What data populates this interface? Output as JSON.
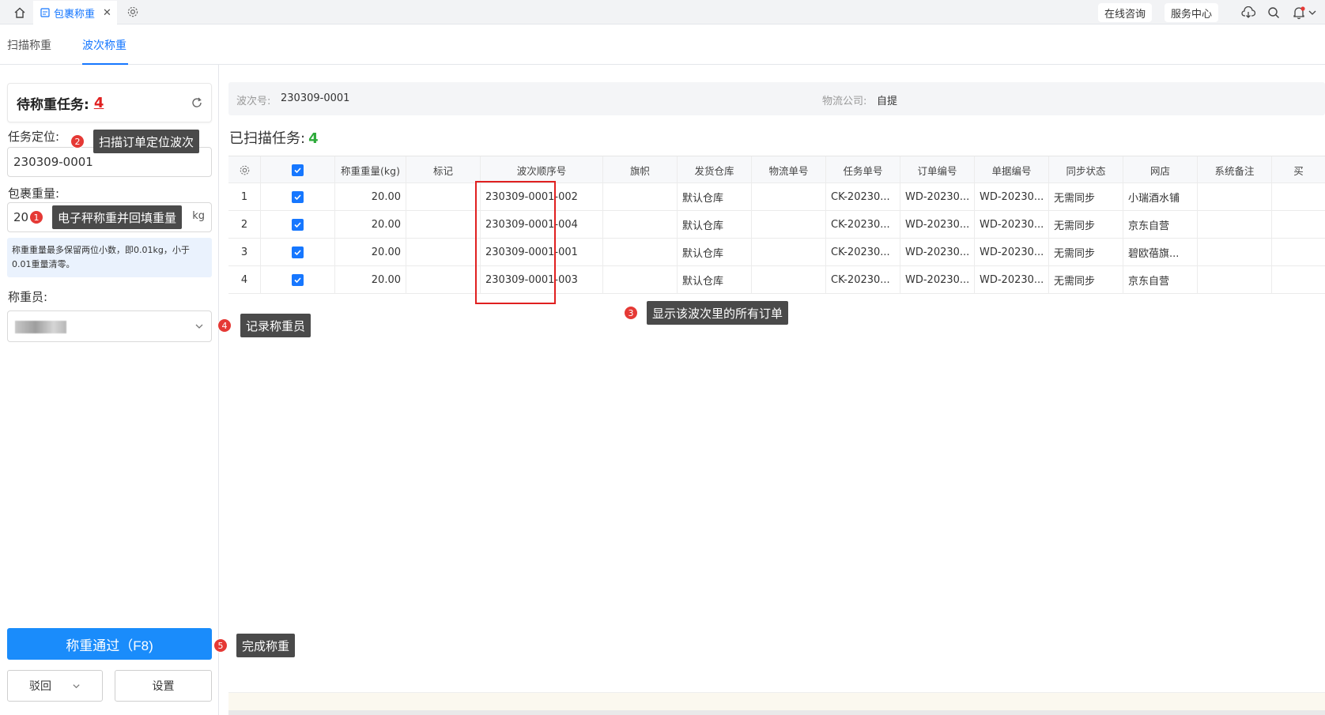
{
  "topbar": {
    "tab_title": "包裹称重",
    "close_glyph": "✕",
    "consult_label": "在线咨询",
    "service_label": "服务中心",
    "icons": [
      "home-icon",
      "tab-page-icon",
      "gear-icon",
      "cloud-download-icon",
      "search-icon",
      "bell-icon"
    ]
  },
  "subtabs": [
    {
      "label": "扫描称重",
      "active": false
    },
    {
      "label": "波次称重",
      "active": true
    }
  ],
  "left": {
    "pending_label": "待称重任务:",
    "pending_count": "4",
    "task_locate_label": "任务定位:",
    "task_locate_value": "230309-0001",
    "package_weight_label": "包裹重量:",
    "package_weight_value": "20",
    "unit": "kg",
    "hint": "称重重量最多保留两位小数，即0.01kg，小于0.01重量清零。",
    "weigher_label": "称重员:",
    "primary_button": "称重通过（F8)",
    "reject_button": "驳回",
    "settings_button": "设置"
  },
  "annotations": [
    {
      "num": "1",
      "text": "电子秤称重并回填重量"
    },
    {
      "num": "2",
      "text": "扫描订单定位波次"
    },
    {
      "num": "3",
      "text": "显示该波次里的所有订单"
    },
    {
      "num": "4",
      "text": "记录称重员"
    },
    {
      "num": "5",
      "text": "完成称重"
    }
  ],
  "info": {
    "wave_label": "波次号:",
    "wave_value": "230309-0001",
    "logistics_label": "物流公司:",
    "logistics_value": "自提"
  },
  "scanned_label": "已扫描任务:",
  "scanned_count": "4",
  "table": {
    "columns": [
      "",
      "",
      "称重重量(kg)",
      "标记",
      "波次顺序号",
      "旗帜",
      "发货仓库",
      "物流单号",
      "任务单号",
      "订单编号",
      "单据编号",
      "同步状态",
      "网店",
      "系统备注",
      "买"
    ],
    "rows": [
      {
        "index": "1",
        "weight": "20.00",
        "mark": "",
        "seq": "230309-0001-002",
        "flag": "",
        "warehouse": "默认仓库",
        "tracking": "",
        "task_no": "CK-20230...",
        "order_no": "WD-20230...",
        "doc_no": "WD-20230...",
        "sync": "无需同步",
        "shop": "小瑞酒水铺",
        "remark": ""
      },
      {
        "index": "2",
        "weight": "20.00",
        "mark": "",
        "seq": "230309-0001-004",
        "flag": "",
        "warehouse": "默认仓库",
        "tracking": "",
        "task_no": "CK-20230...",
        "order_no": "WD-20230...",
        "doc_no": "WD-20230...",
        "sync": "无需同步",
        "shop": "京东自营",
        "remark": ""
      },
      {
        "index": "3",
        "weight": "20.00",
        "mark": "",
        "seq": "230309-0001-001",
        "flag": "",
        "warehouse": "默认仓库",
        "tracking": "",
        "task_no": "CK-20230...",
        "order_no": "WD-20230...",
        "doc_no": "WD-20230...",
        "sync": "无需同步",
        "shop": "碧欧蓓旗...",
        "remark": ""
      },
      {
        "index": "4",
        "weight": "20.00",
        "mark": "",
        "seq": "230309-0001-003",
        "flag": "",
        "warehouse": "默认仓库",
        "tracking": "",
        "task_no": "CK-20230...",
        "order_no": "WD-20230...",
        "doc_no": "WD-20230...",
        "sync": "无需同步",
        "shop": "京东自营",
        "remark": ""
      }
    ]
  },
  "colors": {
    "accent": "#1677ff",
    "danger": "#e02020",
    "success": "#2eaa3b",
    "tooltip": "#4a4a4a"
  }
}
